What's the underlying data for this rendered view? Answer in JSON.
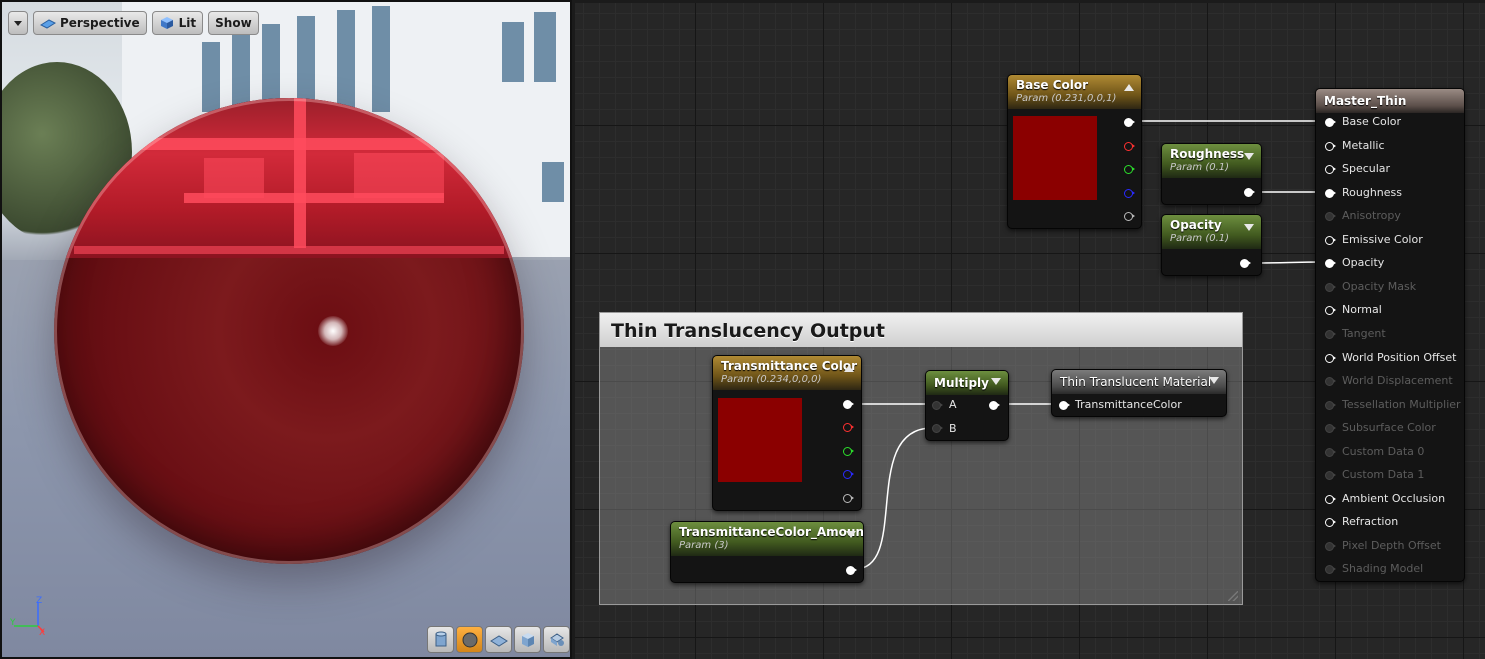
{
  "viewport": {
    "toolbar": {
      "perspective_label": "Perspective",
      "lit_label": "Lit",
      "show_label": "Show"
    },
    "axes": {
      "x": "X",
      "y": "Y",
      "z": "Z"
    },
    "preview_shapes": [
      "cylinder-icon",
      "sphere-icon",
      "plane-icon",
      "cube-icon",
      "custom-mesh-icon"
    ],
    "active_shape": "sphere-icon",
    "material_color": "#8b0000"
  },
  "graph": {
    "comment": {
      "title": "Thin Translucency Output"
    },
    "nodes": {
      "base_color": {
        "title": "Base Color",
        "subtitle": "Param (0.231,0,0,1)",
        "swatch_color": "#8b0000"
      },
      "roughness": {
        "title": "Roughness",
        "subtitle": "Param (0.1)"
      },
      "opacity": {
        "title": "Opacity",
        "subtitle": "Param (0.1)"
      },
      "transmittance_color": {
        "title": "Transmittance Color",
        "subtitle": "Param (0.234,0,0,0)",
        "swatch_color": "#8b0000"
      },
      "transmittance_amount": {
        "title": "TransmittanceColor_Amount",
        "subtitle": "Param (3)"
      },
      "multiply": {
        "title": "Multiply",
        "pin_a": "A",
        "pin_b": "B"
      },
      "thin_translucent": {
        "title": "Thin Translucent Material",
        "pin": "TransmittanceColor"
      },
      "master": {
        "title": "Master_Thin",
        "pins": [
          {
            "label": "Base Color",
            "enabled": true
          },
          {
            "label": "Metallic",
            "enabled": true
          },
          {
            "label": "Specular",
            "enabled": true
          },
          {
            "label": "Roughness",
            "enabled": true
          },
          {
            "label": "Anisotropy",
            "enabled": false
          },
          {
            "label": "Emissive Color",
            "enabled": true
          },
          {
            "label": "Opacity",
            "enabled": true
          },
          {
            "label": "Opacity Mask",
            "enabled": false
          },
          {
            "label": "Normal",
            "enabled": true
          },
          {
            "label": "Tangent",
            "enabled": false
          },
          {
            "label": "World Position Offset",
            "enabled": true
          },
          {
            "label": "World Displacement",
            "enabled": false
          },
          {
            "label": "Tessellation Multiplier",
            "enabled": false
          },
          {
            "label": "Subsurface Color",
            "enabled": false
          },
          {
            "label": "Custom Data 0",
            "enabled": false
          },
          {
            "label": "Custom Data 1",
            "enabled": false
          },
          {
            "label": "Ambient Occlusion",
            "enabled": true
          },
          {
            "label": "Refraction",
            "enabled": true
          },
          {
            "label": "Pixel Depth Offset",
            "enabled": false
          },
          {
            "label": "Shading Model",
            "enabled": false
          }
        ]
      }
    }
  }
}
